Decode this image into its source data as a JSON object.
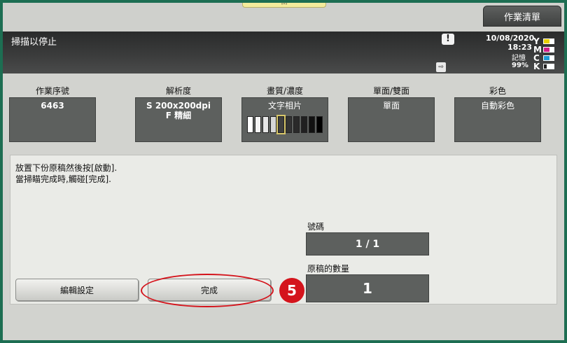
{
  "topbar": {
    "handle_label": "«•»",
    "job_list_label": "作業清單"
  },
  "status": {
    "message": "掃描以停止",
    "warning_symbol": "!",
    "doc_symbol": "⇨",
    "date": "10/08/2020",
    "time": "18:23",
    "memory_label": "記憶",
    "memory_value": "99%",
    "toner": [
      {
        "letter": "Y",
        "level": 0.6,
        "color": "#e8d000"
      },
      {
        "letter": "M",
        "level": 0.6,
        "color": "#d21f8a"
      },
      {
        "letter": "C",
        "level": 0.6,
        "color": "#1f9bd6"
      },
      {
        "letter": "K",
        "level": 0.25,
        "color": "#202020"
      }
    ]
  },
  "settings": {
    "job_number": {
      "label": "作業序號",
      "value": "6463"
    },
    "resolution": {
      "label": "解析度",
      "line1": "S 200x200dpi",
      "line2": "F 精細"
    },
    "quality": {
      "label": "畫質/濃度",
      "value": "文字相片",
      "density_selected_index": 4
    },
    "duplex": {
      "label": "單面/雙面",
      "value": "單面"
    },
    "color": {
      "label": "彩色",
      "value": "自動彩色"
    }
  },
  "main": {
    "message_line1": "放置下份原稿然後按[啟動].",
    "message_line2": "當掃瞄完成時,觸碰[完成].",
    "edit_button": "編輯設定",
    "done_button": "完成",
    "step_number": "5",
    "number_label": "號碼",
    "number_value": "1 / 1",
    "originals_label": "原稿的數量",
    "originals_value": "1"
  },
  "colors": {
    "frame": "#1d6e52",
    "highlight_red": "#d4141c"
  }
}
